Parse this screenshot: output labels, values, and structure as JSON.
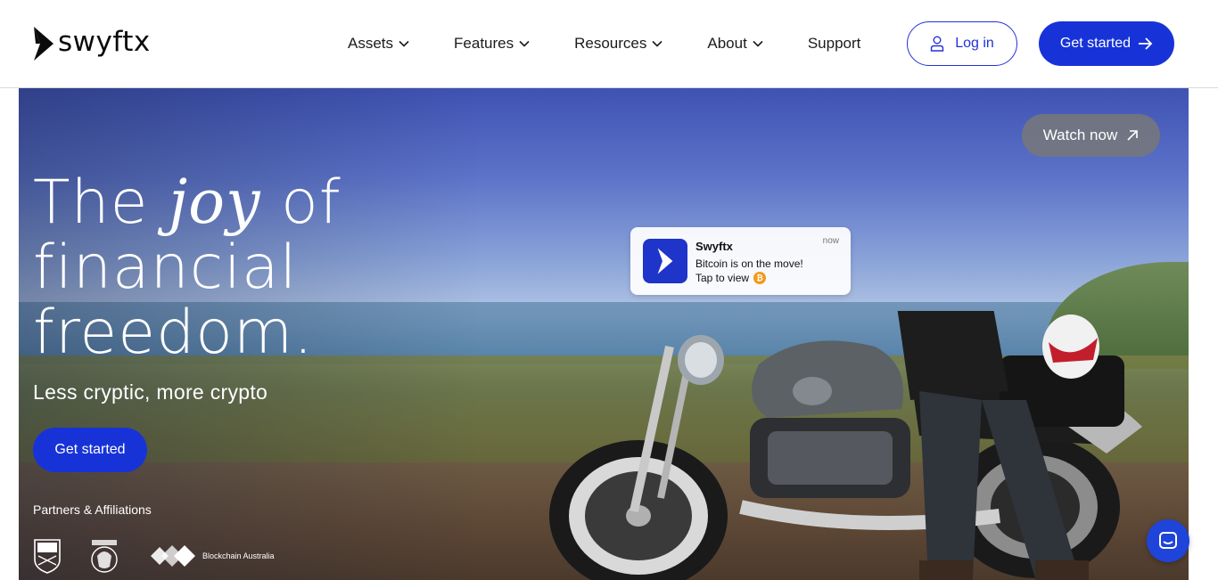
{
  "brand": {
    "name": "swyftx",
    "accent": "#1733d8"
  },
  "nav": {
    "items": [
      {
        "label": "Assets",
        "has_dropdown": true
      },
      {
        "label": "Features",
        "has_dropdown": true
      },
      {
        "label": "Resources",
        "has_dropdown": true
      },
      {
        "label": "About",
        "has_dropdown": true
      },
      {
        "label": "Support",
        "has_dropdown": false
      }
    ],
    "login_label": "Log in",
    "get_started_label": "Get started"
  },
  "hero": {
    "headline_part1": "The ",
    "headline_emphasis": "joy",
    "headline_part2": " of financial freedom.",
    "subheadline": "Less cryptic, more crypto",
    "cta_label": "Get started",
    "watch_now_label": "Watch now",
    "partners_label": "Partners & Affiliations",
    "partners": [
      {
        "name": "NRL"
      },
      {
        "name": "Lions"
      },
      {
        "name": "Blockchain Australia"
      }
    ]
  },
  "notification": {
    "app_name": "Swyftx",
    "time": "now",
    "message": "Bitcoin is on the move!",
    "action": "Tap to view",
    "coin_icon": "bitcoin-icon"
  },
  "chat": {
    "icon": "chat-icon"
  }
}
